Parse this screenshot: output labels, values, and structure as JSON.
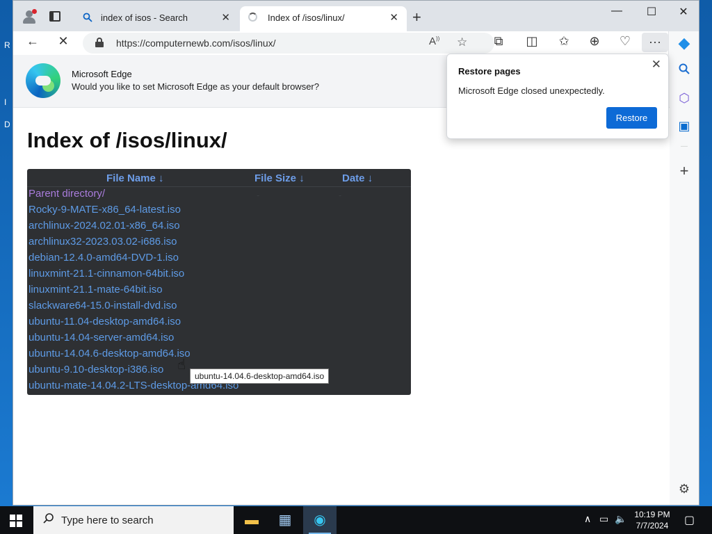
{
  "desktop": {
    "fragments": [
      "R",
      "I",
      "D"
    ]
  },
  "browser": {
    "tabs": [
      {
        "label": "index of isos - Search",
        "icon": "search-icon",
        "active": false
      },
      {
        "label": "Index of /isos/linux/",
        "icon": "loading-icon",
        "active": true
      }
    ],
    "address": "https://computernewb.com/isos/linux/",
    "window_controls": {
      "minimize": "—",
      "maximize": "☐",
      "close": "✕"
    }
  },
  "infobar": {
    "title": "Microsoft Edge",
    "message": "Would you like to set Microsoft Edge as your default browser?"
  },
  "popup": {
    "title": "Restore pages",
    "message": "Microsoft Edge closed unexpectedly.",
    "button": "Restore"
  },
  "page": {
    "heading": "Index of /isos/linux/",
    "columns": {
      "name": "File Name  ↓",
      "size": "File Size  ↓",
      "date": "Date  ↓"
    },
    "rows": [
      {
        "name": "Parent directory/",
        "size": "-",
        "date": "-"
      },
      {
        "name": "Rocky-9-MATE-x86_64-latest.iso",
        "size": "",
        "date": ""
      },
      {
        "name": "archlinux-2024.02.01-x86_64.iso",
        "size": "",
        "date": ""
      },
      {
        "name": "archlinux32-2023.03.02-i686.iso",
        "size": "",
        "date": ""
      },
      {
        "name": "debian-12.4.0-amd64-DVD-1.iso",
        "size": "",
        "date": ""
      },
      {
        "name": "linuxmint-21.1-cinnamon-64bit.iso",
        "size": "",
        "date": ""
      },
      {
        "name": "linuxmint-21.1-mate-64bit.iso",
        "size": "",
        "date": ""
      },
      {
        "name": "slackware64-15.0-install-dvd.iso",
        "size": "",
        "date": ""
      },
      {
        "name": "ubuntu-11.04-desktop-amd64.iso",
        "size": "",
        "date": ""
      },
      {
        "name": "ubuntu-14.04-server-amd64.iso",
        "size": "",
        "date": ""
      },
      {
        "name": "ubuntu-14.04.6-desktop-amd64.iso",
        "size": "",
        "date": ""
      },
      {
        "name": "ubuntu-9.10-desktop-i386.iso",
        "size": "",
        "date": ""
      },
      {
        "name": "ubuntu-mate-14.04.2-LTS-desktop-amd64.iso",
        "size": "",
        "date": ""
      }
    ],
    "tooltip": "ubuntu-14.04.6-desktop-amd64.iso"
  },
  "taskbar": {
    "search_placeholder": "Type here to search",
    "time": "10:19 PM",
    "date": "7/7/2024"
  },
  "colors": {
    "accent": "#0d6ad6",
    "link": "#5e9be6",
    "visited": "#a97cdc",
    "table_bg": "#2e3033"
  }
}
